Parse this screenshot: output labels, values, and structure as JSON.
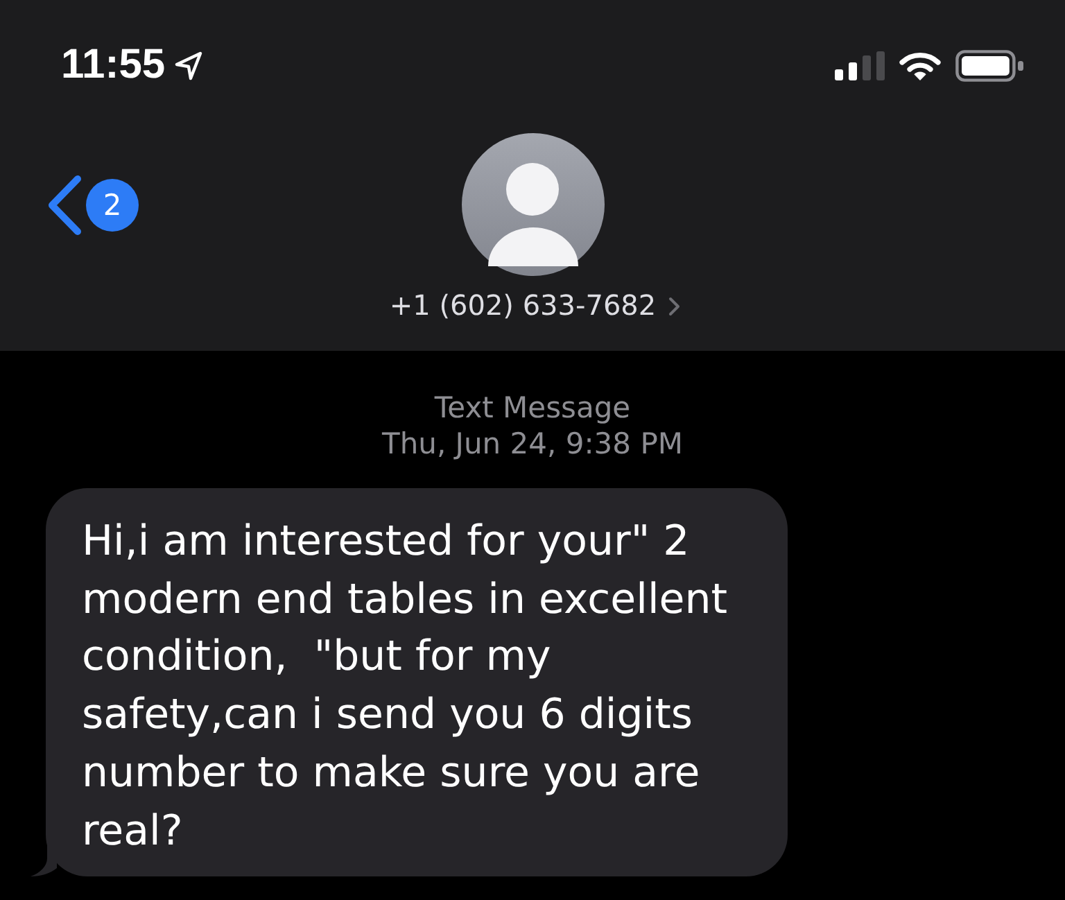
{
  "status_bar": {
    "time": "11:55"
  },
  "nav_bar": {
    "back_badge": "2",
    "contact": "+1 (602) 633-7682"
  },
  "conversation": {
    "service_label": "Text Message",
    "timestamp": "Thu, Jun 24, 9:38 PM",
    "messages": [
      {
        "kind": "incoming",
        "text": "Hi,i am interested for your\" 2 modern end tables in excellent condition,  \"but for my safety,can i send you 6 digits number to make sure you are real?"
      }
    ]
  }
}
